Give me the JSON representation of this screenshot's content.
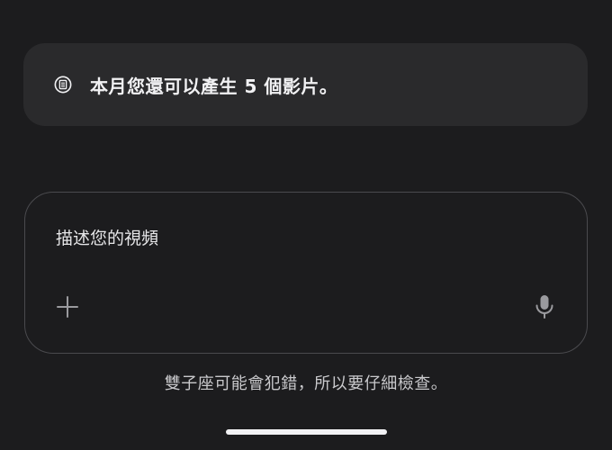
{
  "quota_banner": {
    "icon": "document-icon",
    "text": "本月您還可以產生 5 個影片。"
  },
  "prompt": {
    "placeholder": "描述您的視頻",
    "value": "",
    "add_icon": "plus-icon",
    "mic_icon": "microphone-icon"
  },
  "disclaimer": {
    "text": "雙子座可能會犯錯，所以要仔細檢查。"
  },
  "colors": {
    "background": "#1c1c1e",
    "banner_background": "#2a2a2c",
    "input_border": "#4a4a4e",
    "text_primary": "#f1f1f3",
    "icon_gray": "#9a9a9e"
  }
}
